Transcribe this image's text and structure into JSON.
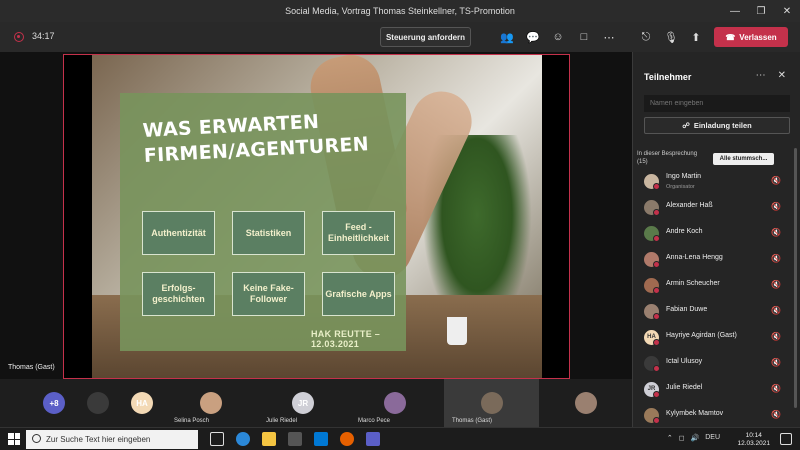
{
  "window": {
    "title": "Social Media, Vortrag Thomas Steinkellner, TS-Promotion"
  },
  "toolbar": {
    "timer": "34:17",
    "request_control": "Steuerung anfordern",
    "leave": "Verlassen"
  },
  "slide": {
    "title_line1": "WAS ERWARTEN",
    "title_line2": "FIRMEN/AGENTUREN",
    "boxes": [
      "Authentizität",
      "Statistiken",
      "Feed - Einheitlichkeit",
      "Erfolgs- geschichten",
      "Keine Fake- Follower",
      "Grafische Apps"
    ],
    "footer": "HAK REUTTE – 12.03.2021"
  },
  "presenter_label": "Thomas (Gast)",
  "participants_panel": {
    "title": "Teilnehmer",
    "search_placeholder": "Namen eingeben",
    "invite_label": "Einladung teilen",
    "section_heading_line1": "In dieser Besprechung",
    "section_heading_line2": "(15)",
    "mute_all": "Alle stummsch...",
    "people": [
      {
        "name": "Ingo Martin",
        "role": "Organisator",
        "initials": "",
        "avatar_color": "#c9b6a0"
      },
      {
        "name": "Alexander Haß",
        "role": "",
        "initials": "",
        "avatar_color": "#8a7a6a"
      },
      {
        "name": "Andre Koch",
        "role": "",
        "initials": "",
        "avatar_color": "#5a7a4a"
      },
      {
        "name": "Anna-Lena Hengg",
        "role": "",
        "initials": "",
        "avatar_color": "#b07a6a"
      },
      {
        "name": "Armin Scheucher",
        "role": "",
        "initials": "",
        "avatar_color": "#a06a50"
      },
      {
        "name": "Fabian Duwe",
        "role": "",
        "initials": "",
        "avatar_color": "#9a8070"
      },
      {
        "name": "Hayriye Agirdan (Gast)",
        "role": "",
        "initials": "HA",
        "avatar_color": "#f3d9b5"
      },
      {
        "name": "Ictal Ulusoy",
        "role": "",
        "initials": "",
        "avatar_color": "#3a3a3a"
      },
      {
        "name": "Julie Riedel",
        "role": "",
        "initials": "JR",
        "avatar_color": "#cfcfd6"
      },
      {
        "name": "Kylymbek Mamtov",
        "role": "",
        "initials": "",
        "avatar_color": "#9a7a5a"
      }
    ]
  },
  "strip": {
    "overflow_count": "+8",
    "tiles": [
      {
        "name": "",
        "initials": "",
        "color": "#3a3a3a"
      },
      {
        "name": "",
        "initials": "HA",
        "color": "#f3d9b5"
      },
      {
        "name": "Selina Posch",
        "initials": "",
        "color": "#c9a080"
      },
      {
        "name": "Julie Riedel",
        "initials": "JR",
        "color": "#cfcfd6"
      },
      {
        "name": "Marco Pece",
        "initials": "",
        "color": "#8a6a9a"
      },
      {
        "name": "Thomas (Gast)",
        "initials": "",
        "color": "#7a6a5a"
      },
      {
        "name": "",
        "initials": "",
        "color": "#9a8070"
      }
    ]
  },
  "taskbar": {
    "search_placeholder": "Zur Suche Text hier eingeben",
    "language": "DEU",
    "time": "10:14",
    "date": "12.03.2021"
  }
}
